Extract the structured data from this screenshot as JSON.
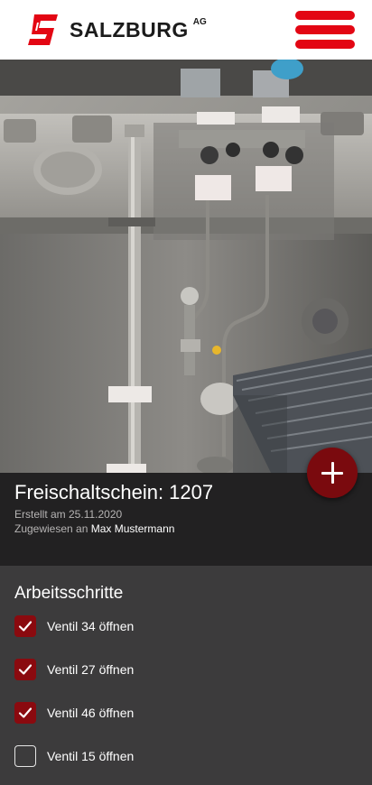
{
  "header": {
    "brand": "SALZBURG",
    "brand_suffix": "AG",
    "logo_icon": "salzburg-ag-logo",
    "menu_icon": "hamburger-menu-icon",
    "accent_color": "#e30613"
  },
  "hero": {
    "image": "industrial-valve-pipes-photo"
  },
  "ticket": {
    "title": "Freischaltschein: 1207",
    "created": "Erstellt am 25.11.2020",
    "assigned_label": "Zugewiesen an",
    "assignee": "Max Mustermann"
  },
  "fab": {
    "icon": "plus-icon",
    "color": "#7a0a0e"
  },
  "steps": {
    "heading": "Arbeitsschritte",
    "check_color": "#8a0a0f",
    "items": [
      {
        "label": "Ventil 34 öffnen",
        "checked": true
      },
      {
        "label": "Ventil 27 öffnen",
        "checked": true
      },
      {
        "label": "Ventil 46 öffnen",
        "checked": true
      },
      {
        "label": "Ventil 15 öffnen",
        "checked": false
      }
    ]
  }
}
